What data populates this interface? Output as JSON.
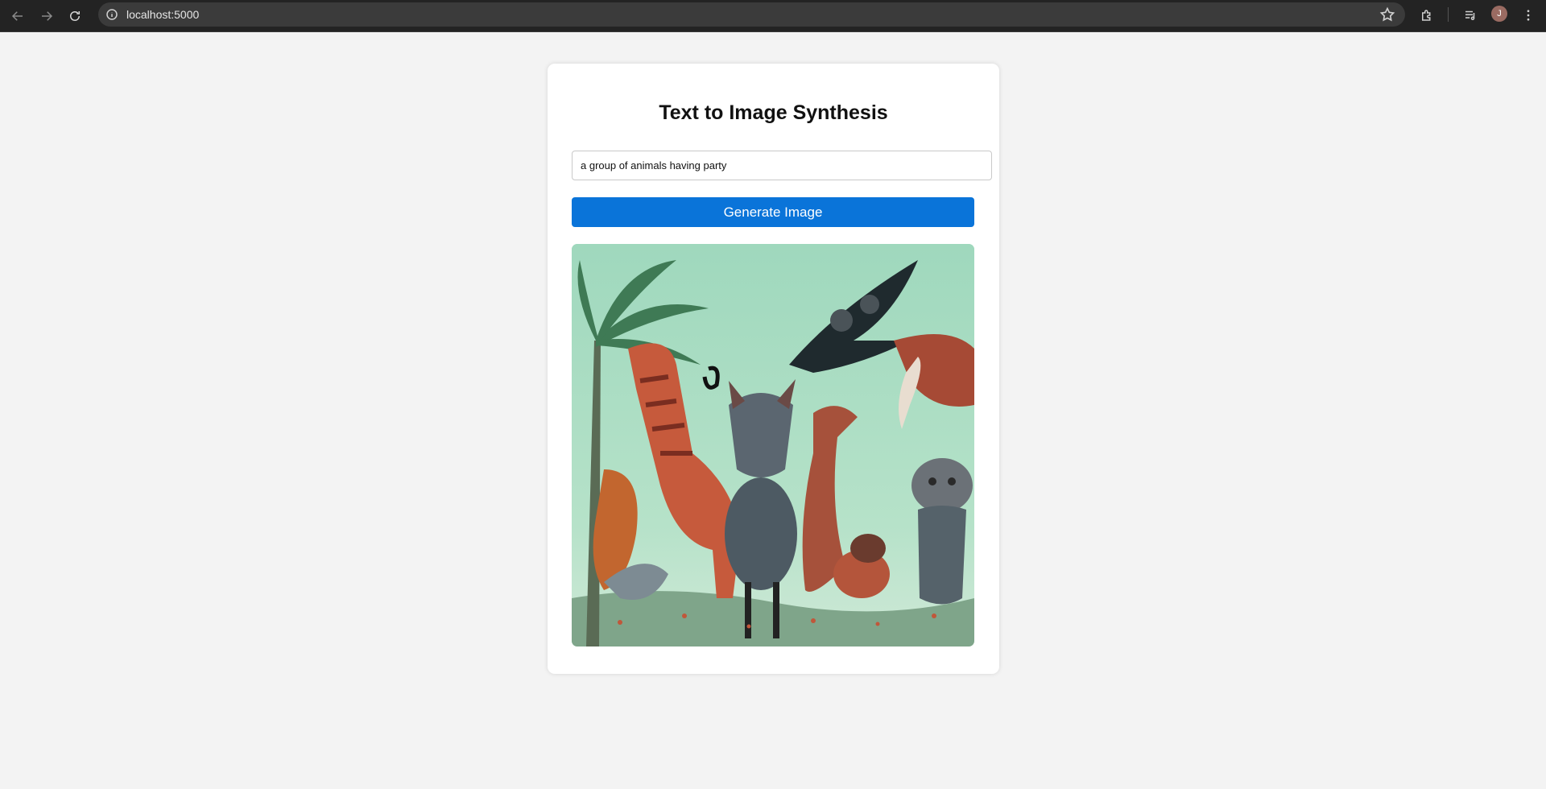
{
  "browser": {
    "url": "localhost:5000",
    "avatar_initial": "J"
  },
  "app": {
    "title": "Text to Image Synthesis",
    "prompt_value": "a group of animals having party",
    "generate_label": "Generate Image",
    "image_description_icon": "generated-image",
    "accent_color": "#0a74d9"
  }
}
